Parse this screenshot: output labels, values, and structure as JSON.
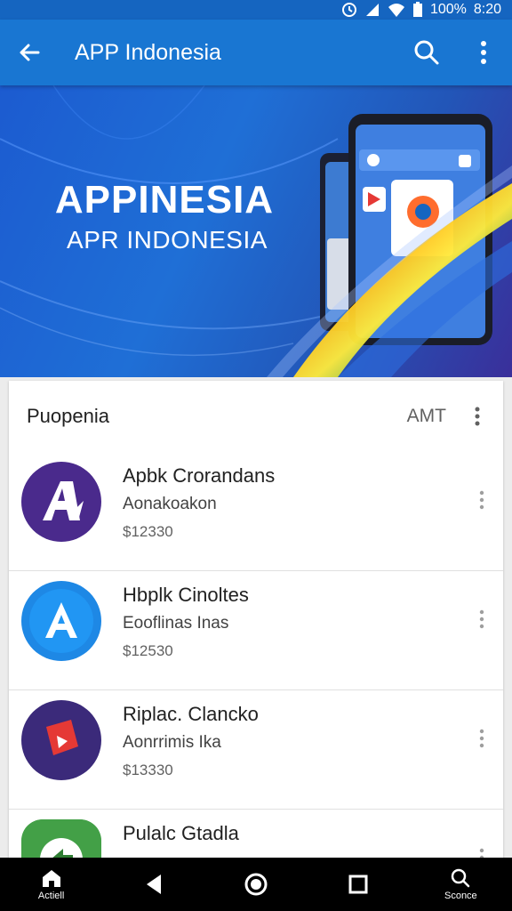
{
  "status_bar": {
    "battery_text": "100%",
    "time": "8:20"
  },
  "app_bar": {
    "title": "APP Indonesia"
  },
  "banner": {
    "title": "APPINESIA",
    "subtitle": "APR INDONESIA"
  },
  "section": {
    "title": "Puopenia",
    "action": "AMT"
  },
  "apps": [
    {
      "name": "Apbk Crorandans",
      "subtitle": "Aonakoakon",
      "size": "$12330",
      "icon": "apbk-app-icon",
      "color": "#4a2a8c"
    },
    {
      "name": "Hbplk Cinoltes",
      "subtitle": "Eooflinas Inas",
      "size": "$12530",
      "icon": "app-store-a-icon",
      "color": "#1e88e5"
    },
    {
      "name": "Riplac. Clancko",
      "subtitle": "Aonrrimis Ika",
      "size": "$13330",
      "icon": "video-play-icon",
      "color": "#3b2a7a"
    },
    {
      "name": "Pulalc Gtadla",
      "subtitle": "",
      "size": "",
      "icon": "green-arrow-icon",
      "color": "#43a047"
    }
  ],
  "nav_bar": {
    "left_label": "Actiell",
    "right_label": "Sconce"
  }
}
